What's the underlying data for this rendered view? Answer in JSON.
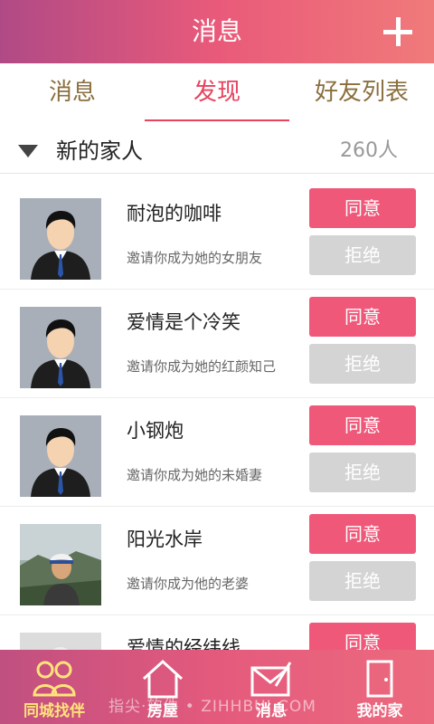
{
  "header": {
    "title": "消息",
    "add_icon": "plus-icon"
  },
  "tabs": [
    {
      "label": "消息",
      "active": false
    },
    {
      "label": "发现",
      "active": true
    },
    {
      "label": "好友列表",
      "active": false
    }
  ],
  "group": {
    "name": "新的家人",
    "count": "260人",
    "icon": "triangle-down-icon"
  },
  "requests": [
    {
      "name": "耐泡的咖啡",
      "message": "邀请你成为她的女朋友",
      "agree": "同意",
      "reject": "拒绝",
      "avatar": "default-avatar"
    },
    {
      "name": "爱情是个冷笑",
      "message": "邀请你成为她的红颜知己",
      "agree": "同意",
      "reject": "拒绝",
      "avatar": "default-avatar"
    },
    {
      "name": "小钢炮",
      "message": "邀请你成为她的未婚妻",
      "agree": "同意",
      "reject": "拒绝",
      "avatar": "default-avatar"
    },
    {
      "name": "阳光水岸",
      "message": "邀请你成为他的老婆",
      "agree": "同意",
      "reject": "拒绝",
      "avatar": "photo-avatar"
    },
    {
      "name": "爱情的经纬线",
      "message": "",
      "agree": "同意",
      "reject": "",
      "avatar": "default-avatar"
    }
  ],
  "tabbar": [
    {
      "label": "同城找伴",
      "icon": "people-icon",
      "active": true
    },
    {
      "label": "房屋",
      "icon": "house-icon",
      "active": false
    },
    {
      "label": "消息",
      "icon": "message-icon",
      "active": false
    },
    {
      "label": "我的家",
      "icon": "door-icon",
      "active": false
    }
  ],
  "watermark": "指尖·软件 • ZIHHBUI.COM",
  "colors": {
    "accent": "#e8425e",
    "agree": "#f0587a",
    "reject": "#d4d4d4",
    "header": "#e95a7a"
  }
}
